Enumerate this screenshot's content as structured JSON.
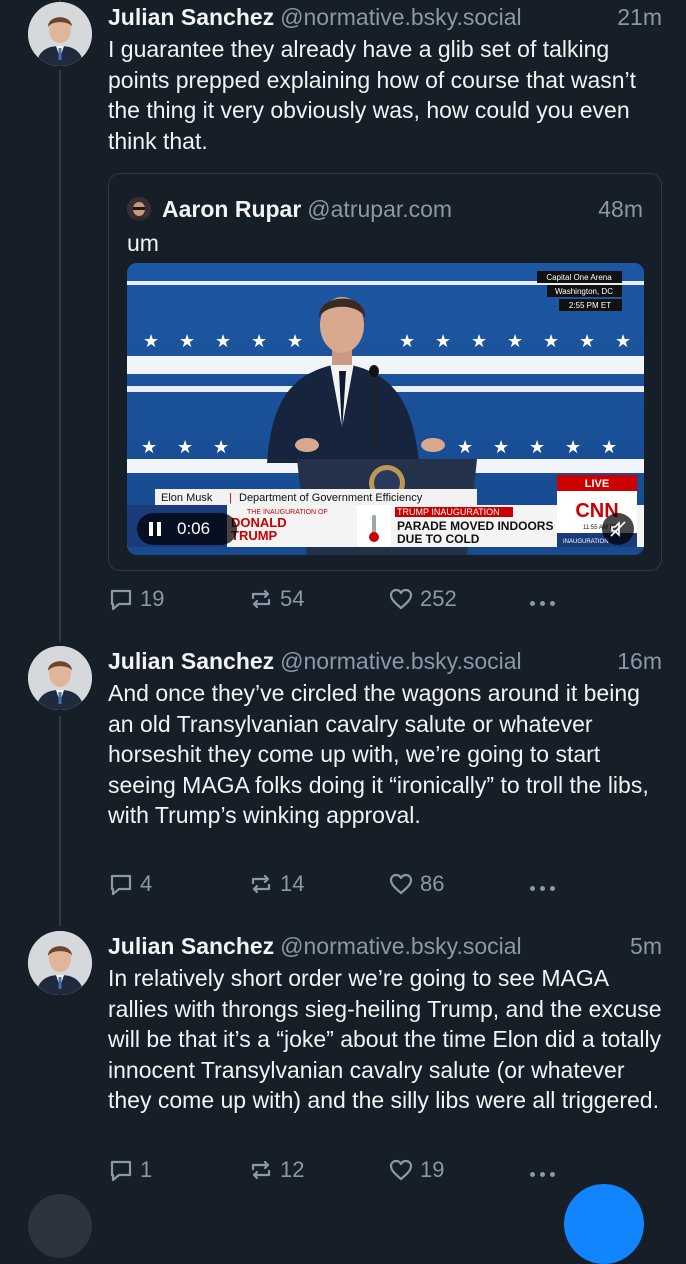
{
  "posts": [
    {
      "author": "Julian Sanchez",
      "handle": "@normative.bsky.social",
      "time": "21m",
      "text": "I guarantee they already have a glib set of talking points prepped explaining how of course that wasn’t the thing it very obviously was, how could you even think that.",
      "quote": {
        "author": "Aaron Rupar",
        "handle": "@atrupar.com",
        "time": "48m",
        "text": "um",
        "video": {
          "location_line1": "Capital One Arena",
          "location_line2": "Washington, DC",
          "location_time": "2:55 PM ET",
          "speaker_chyron": "Elon Musk",
          "speaker_title": "Department of Government Efficiency",
          "event_small": "THE INAUGURATION OF",
          "event_name_1": "DONALD",
          "event_name_2": "TRUMP",
          "news_tag": "TRUMP INAUGURATION",
          "headline_1": "PARADE MOVED INDOORS",
          "headline_2": "DUE TO COLD",
          "live_label": "LIVE",
          "network": "CNN",
          "clock": "11:55 AM PT",
          "corner_tag": "INAUGURATION",
          "elapsed": "0:06"
        }
      },
      "replies": "19",
      "reposts": "54",
      "likes": "252"
    },
    {
      "author": "Julian Sanchez",
      "handle": "@normative.bsky.social",
      "time": "16m",
      "text": "And once they’ve circled the wagons around it being an old Transylvanian cavalry salute or whatever horseshit they come up with, we’re going to start seeing MAGA folks doing it “ironically” to troll the libs, with Trump’s winking approval.",
      "replies": "4",
      "reposts": "14",
      "likes": "86"
    },
    {
      "author": "Julian Sanchez",
      "handle": "@normative.bsky.social",
      "time": "5m",
      "text": "In relatively short order we’re going to see MAGA rallies with throngs sieg-heiling Trump, and the excuse will be that it’s a “joke” about the time Elon did a totally innocent Transylvanian cavalry salute (or whatever they come up with) and the silly libs were all triggered.",
      "replies": "1",
      "reposts": "12",
      "likes": "19"
    }
  ],
  "colors": {
    "background": "#161e27",
    "muted": "#8b98a8",
    "thread_line": "#2e3a47",
    "fab": "#1185fe",
    "cnn_red": "#cc0000"
  },
  "icons": [
    "reply-icon",
    "repost-icon",
    "like-icon",
    "more-options-icon",
    "pause-icon",
    "mute-icon"
  ]
}
